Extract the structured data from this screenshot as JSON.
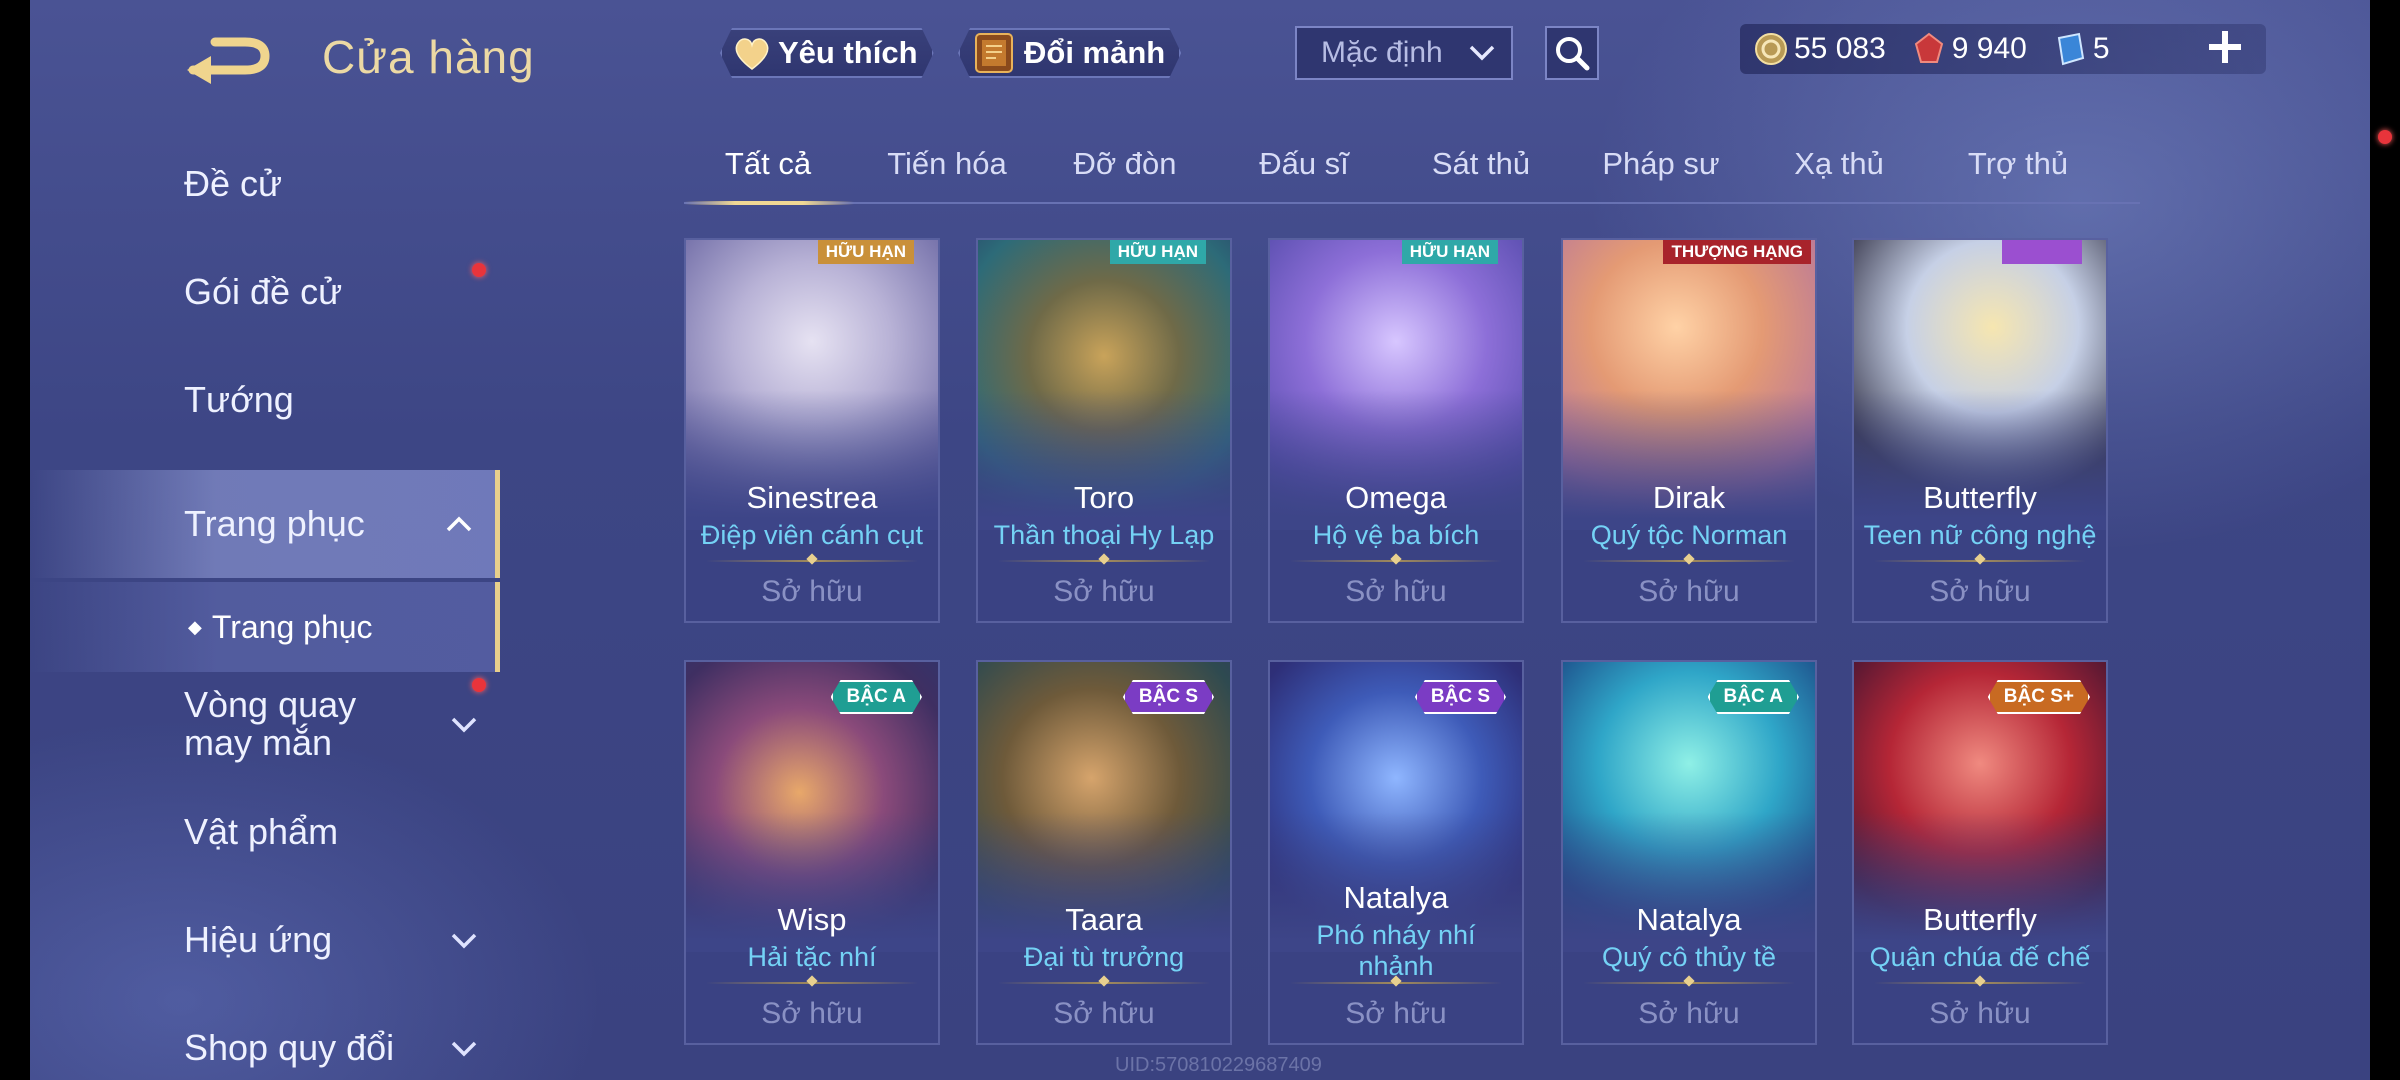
{
  "header": {
    "title": "Cửa hàng",
    "favorites_label": "Yêu thích",
    "exchange_label": "Đổi mảnh",
    "sort_value": "Mặc định"
  },
  "currency": {
    "gold": "55 083",
    "vouchers": "9 940",
    "tickets": "5"
  },
  "sidebar": {
    "items": [
      {
        "label": "Đề cử"
      },
      {
        "label": "Gói đề cử"
      },
      {
        "label": "Tướng"
      },
      {
        "label": "Trang phục"
      },
      {
        "label": "Trang phục"
      },
      {
        "label": "Vòng quay may mắn"
      },
      {
        "label": "Vật phẩm"
      },
      {
        "label": "Hiệu ứng"
      },
      {
        "label": "Shop quy đổi"
      }
    ]
  },
  "tabs": [
    "Tất cả",
    "Tiến hóa",
    "Đỡ đòn",
    "Đấu sĩ",
    "Sát thủ",
    "Pháp sư",
    "Xạ thủ",
    "Trợ thủ"
  ],
  "cards": [
    {
      "hero": "Sinestrea",
      "skin": "Điệp viên cánh cụt",
      "status": "Sở hữu",
      "tag": "HỮU HẠN",
      "tag_color": "#c9903a"
    },
    {
      "hero": "Toro",
      "skin": "Thần thoại Hy Lạp",
      "status": "Sở hữu",
      "tag": "HỮU HẠN",
      "tag_color": "#2fa8a8"
    },
    {
      "hero": "Omega",
      "skin": "Hộ vệ ba bích",
      "status": "Sở hữu",
      "tag": "HỮU HẠN",
      "tag_color": "#2fa8a8"
    },
    {
      "hero": "Dirak",
      "skin": "Quý tộc Norman",
      "status": "Sở hữu",
      "tag": "THƯỢNG HẠNG",
      "tag_color": "#a8232b"
    },
    {
      "hero": "Butterfly",
      "skin": "Teen nữ công nghệ",
      "status": "Sở hữu",
      "tag": "",
      "tag_color": "#9b4fd0"
    },
    {
      "hero": "Wisp",
      "skin": "Hải tặc nhí",
      "status": "Sở hữu",
      "badge": "BẬC A",
      "badge_color": "#1f9e93"
    },
    {
      "hero": "Taara",
      "skin": "Đại tù trưởng",
      "status": "Sở hữu",
      "badge": "BẬC S",
      "badge_color": "#7b3cc4"
    },
    {
      "hero": "Natalya",
      "skin": "Phó nháy nhí nhảnh",
      "status": "Sở hữu",
      "badge": "BẬC S",
      "badge_color": "#7b3cc4"
    },
    {
      "hero": "Natalya",
      "skin": "Quý cô thủy tề",
      "status": "Sở hữu",
      "badge": "BẬC A",
      "badge_color": "#1f9e93"
    },
    {
      "hero": "Butterfly",
      "skin": "Quận chúa đế chế",
      "status": "Sở hữu",
      "badge": "BẬC S+",
      "badge_color": "#c86a22"
    }
  ],
  "watermark": "UID:570810229687409"
}
